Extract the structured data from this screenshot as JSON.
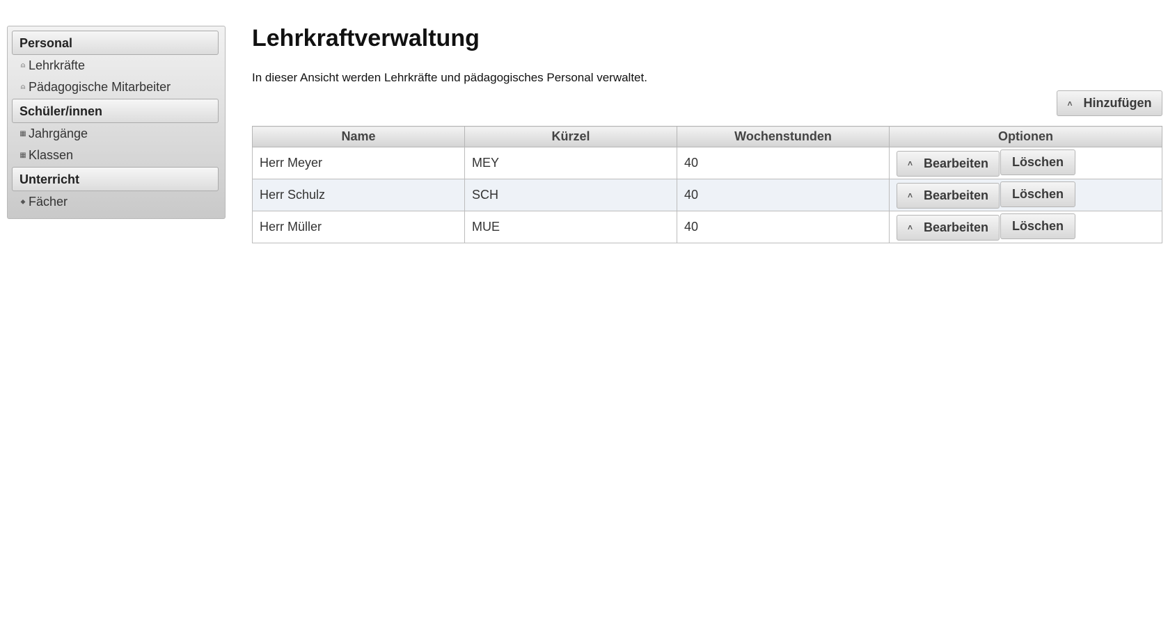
{
  "sidebar": {
    "sections": [
      {
        "title": "Personal",
        "items": [
          {
            "label": "Lehrkräfte",
            "icon": "person-icon",
            "glyph": "⍝"
          },
          {
            "label": "Pädagogische Mitarbeiter",
            "icon": "person-icon",
            "glyph": "⍝"
          }
        ]
      },
      {
        "title": "Schüler/innen",
        "items": [
          {
            "label": "Jahrgänge",
            "icon": "grid-icon",
            "glyph": "▦"
          },
          {
            "label": "Klassen",
            "icon": "grid-icon",
            "glyph": "▦"
          }
        ]
      },
      {
        "title": "Unterricht",
        "items": [
          {
            "label": "Fächer",
            "icon": "tag-icon",
            "glyph": "⬥"
          }
        ]
      }
    ]
  },
  "main": {
    "title": "Lehrkraftverwaltung",
    "description": "In dieser Ansicht werden Lehrkräfte und pädagogisches Personal verwaltet.",
    "add_button": "Hinzufügen",
    "table": {
      "headers": [
        "Name",
        "Kürzel",
        "Wochenstunden",
        "Optionen"
      ],
      "rows": [
        {
          "name": "Herr Meyer",
          "kuerzel": "MEY",
          "wochenstunden": "40"
        },
        {
          "name": "Herr Schulz",
          "kuerzel": "SCH",
          "wochenstunden": "40"
        },
        {
          "name": "Herr Müller",
          "kuerzel": "MUE",
          "wochenstunden": "40"
        }
      ],
      "edit_label": "Bearbeiten",
      "delete_label": "Löschen"
    }
  }
}
